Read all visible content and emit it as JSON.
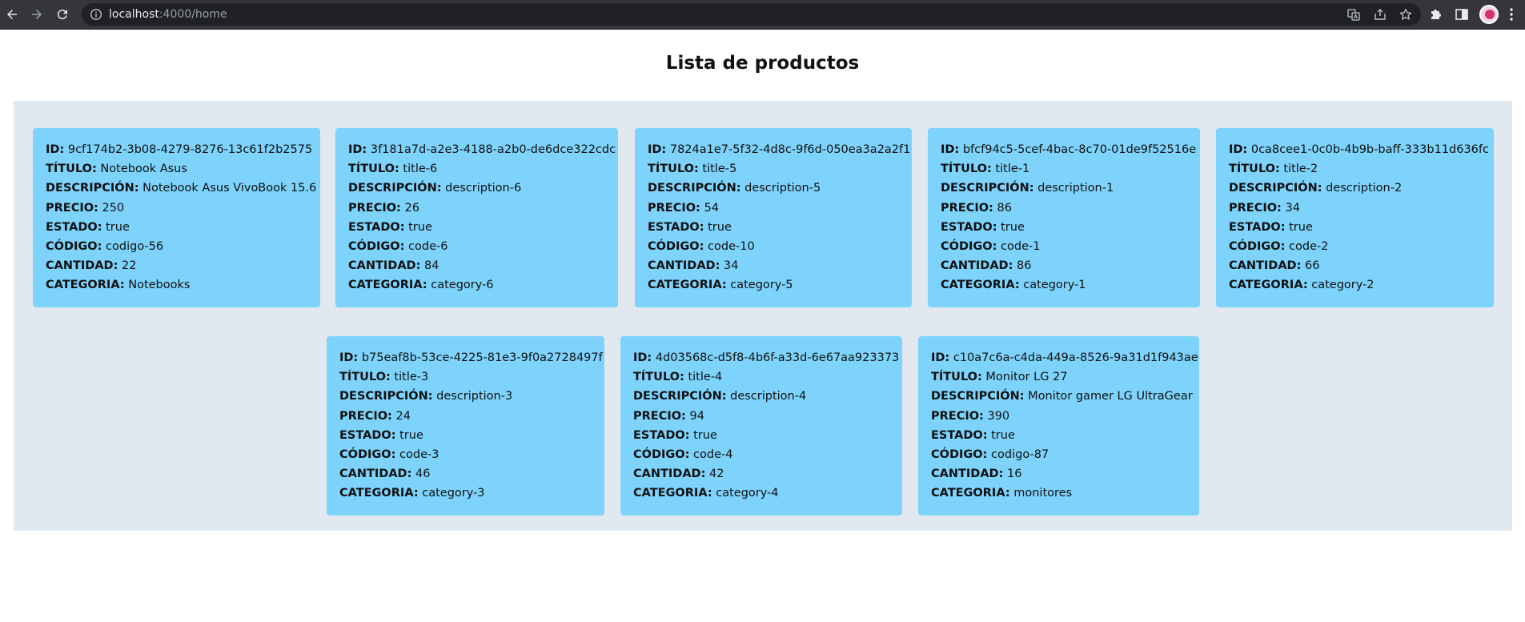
{
  "browser": {
    "url_host": "localhost",
    "url_path": ":4000/home",
    "icons": [
      "back-arrow-icon",
      "forward-arrow-icon",
      "reload-icon",
      "info-icon",
      "translate-icon",
      "share-icon",
      "star-icon",
      "extensions-puzzle-icon",
      "side-panel-icon",
      "profile-avatar",
      "kebab-menu-icon"
    ]
  },
  "page": {
    "title": "Lista de productos"
  },
  "labels": {
    "id": "ID:",
    "titulo": "TÍTULO:",
    "descripcion": "DESCRIPCIÓN:",
    "precio": "PRECIO:",
    "estado": "ESTADO:",
    "codigo": "CÓDIGO:",
    "cantidad": "CANTIDAD:",
    "categoria": "CATEGORIA:"
  },
  "products": [
    {
      "id": "9cf174b2-3b08-4279-8276-13c61f2b2575",
      "titulo": "Notebook Asus",
      "descripcion": "Notebook Asus VivoBook 15.6",
      "precio": "250",
      "estado": "true",
      "codigo": "codigo-56",
      "cantidad": "22",
      "categoria": "Notebooks"
    },
    {
      "id": "3f181a7d-a2e3-4188-a2b0-de6dce322cdc",
      "titulo": "title-6",
      "descripcion": "description-6",
      "precio": "26",
      "estado": "true",
      "codigo": "code-6",
      "cantidad": "84",
      "categoria": "category-6"
    },
    {
      "id": "7824a1e7-5f32-4d8c-9f6d-050ea3a2a2f1",
      "titulo": "title-5",
      "descripcion": "description-5",
      "precio": "54",
      "estado": "true",
      "codigo": "code-10",
      "cantidad": "34",
      "categoria": "category-5"
    },
    {
      "id": "bfcf94c5-5cef-4bac-8c70-01de9f52516e",
      "titulo": "title-1",
      "descripcion": "description-1",
      "precio": "86",
      "estado": "true",
      "codigo": "code-1",
      "cantidad": "86",
      "categoria": "category-1"
    },
    {
      "id": "0ca8cee1-0c0b-4b9b-baff-333b11d636fc",
      "titulo": "title-2",
      "descripcion": "description-2",
      "precio": "34",
      "estado": "true",
      "codigo": "code-2",
      "cantidad": "66",
      "categoria": "category-2"
    },
    {
      "id": "b75eaf8b-53ce-4225-81e3-9f0a2728497f",
      "titulo": "title-3",
      "descripcion": "description-3",
      "precio": "24",
      "estado": "true",
      "codigo": "code-3",
      "cantidad": "46",
      "categoria": "category-3"
    },
    {
      "id": "4d03568c-d5f8-4b6f-a33d-6e67aa923373",
      "titulo": "title-4",
      "descripcion": "description-4",
      "precio": "94",
      "estado": "true",
      "codigo": "code-4",
      "cantidad": "42",
      "categoria": "category-4"
    },
    {
      "id": "c10a7c6a-c4da-449a-8526-9a31d1f943ae",
      "titulo": "Monitor LG 27",
      "descripcion": "Monitor gamer LG UltraGear",
      "precio": "390",
      "estado": "true",
      "codigo": "codigo-87",
      "cantidad": "16",
      "categoria": "monitores"
    }
  ]
}
